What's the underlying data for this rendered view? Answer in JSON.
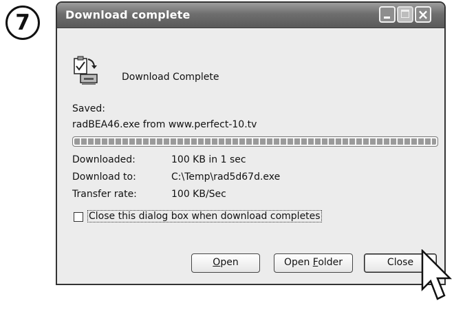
{
  "step": {
    "number": "7"
  },
  "window": {
    "title": "Download complete"
  },
  "dialog": {
    "heading": "Download Complete",
    "saved_label": "Saved:",
    "saved_value": "radBEA46.exe from www.perfect-10.tv",
    "progress_fraction": 1.0,
    "rows": [
      {
        "label": "Downloaded:",
        "value": "100 KB in 1 sec"
      },
      {
        "label": "Download to:",
        "value": "C:\\Temp\\rad5d67d.exe"
      },
      {
        "label": "Transfer rate:",
        "value": "100 KB/Sec"
      }
    ],
    "close_checkbox": {
      "label": "Close this dialog box when download completes",
      "checked": false
    }
  },
  "buttons": {
    "open": {
      "accel": "O",
      "rest": "pen"
    },
    "open_folder": {
      "pre": "Open ",
      "accel": "F",
      "rest": "older"
    },
    "close": "Close"
  },
  "icons": {
    "download": "download-complete-icon",
    "cursor": "mouse-pointer-icon"
  },
  "colors": {
    "titlebar": "#6e6e6e",
    "dialog_bg": "#ececec",
    "progress_segment": "#9a9a9a"
  }
}
